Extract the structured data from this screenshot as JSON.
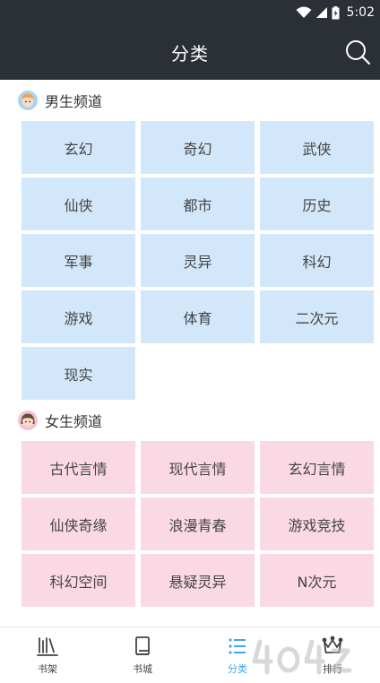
{
  "status": {
    "time": "5:02"
  },
  "header": {
    "title": "分类"
  },
  "sections": [
    {
      "label": "男生频道",
      "items": [
        "玄幻",
        "奇幻",
        "武侠",
        "仙侠",
        "都市",
        "历史",
        "军事",
        "灵异",
        "科幻",
        "游戏",
        "体育",
        "二次元",
        "现实"
      ]
    },
    {
      "label": "女生频道",
      "items": [
        "古代言情",
        "现代言情",
        "玄幻言情",
        "仙侠奇缘",
        "浪漫青春",
        "游戏竞技",
        "科幻空间",
        "悬疑灵异",
        "N次元"
      ]
    }
  ],
  "tabs": [
    {
      "label": "书架",
      "icon": "bookshelf-icon"
    },
    {
      "label": "书城",
      "icon": "book-icon"
    },
    {
      "label": "分类",
      "icon": "list-icon",
      "active": true
    },
    {
      "label": "排行",
      "icon": "crown-icon"
    }
  ],
  "colors": {
    "accent": "#3fa7ec",
    "header": "#2b2f36",
    "male_cell": "#d3e7fb",
    "female_cell": "#fbd9e4"
  }
}
